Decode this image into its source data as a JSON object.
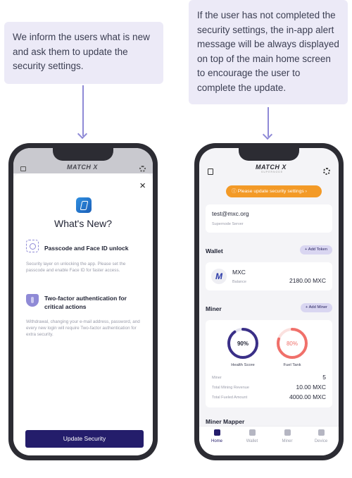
{
  "notes": {
    "left": "We inform the users what is new and ask them to update the security settings.",
    "right": "If the user has not completed the security settings, the in-app alert message will be always displayed on top of the main home screen to encourage the user to complete the update."
  },
  "app": {
    "logo": "MATCH X",
    "logo_sub": "SUPERNODE"
  },
  "whats_new": {
    "title": "What's New?",
    "close": "×",
    "features": [
      {
        "title": "Passcode and Face ID unlock",
        "description": "Security layer on unlocking the app. Please set the passcode and enable Face ID for faster access."
      },
      {
        "title": "Two-factor authentication for critical actions",
        "description": "Withdrawal, changing your e-mail address, password, and every new login will require Two-factor authentication for extra security."
      }
    ],
    "button": "Update Security"
  },
  "home": {
    "alert": "Please update security settings",
    "account": {
      "email": "test@mxc.org",
      "server": "Supernode Server"
    },
    "wallet": {
      "title": "Wallet",
      "add_label": "+ Add Token",
      "token": {
        "name": "MXC",
        "label": "Balance",
        "value": "2180.00 MXC"
      }
    },
    "miner": {
      "title": "Miner",
      "add_label": "+ Add Miner",
      "health": {
        "value": "90%",
        "label": "Health Score",
        "fraction": 0.9,
        "color": "#3a2f87"
      },
      "fuel": {
        "value": "80%",
        "label": "Fuel Tank",
        "fraction": 0.8,
        "color": "#f0706a"
      },
      "stats": [
        {
          "label": "Miner",
          "value": "5"
        },
        {
          "label": "Total Mining Revenue",
          "value": "10.00 MXC"
        },
        {
          "label": "Total Fueled Amount",
          "value": "4000.00 MXC"
        }
      ]
    },
    "miner_mapper": "Miner Mapper",
    "tabs": [
      "Home",
      "Wallet",
      "Miner",
      "Device"
    ]
  },
  "colors": {
    "primary": "#241d6b",
    "accent": "#8f8ad6",
    "alert": "#f39a27"
  }
}
